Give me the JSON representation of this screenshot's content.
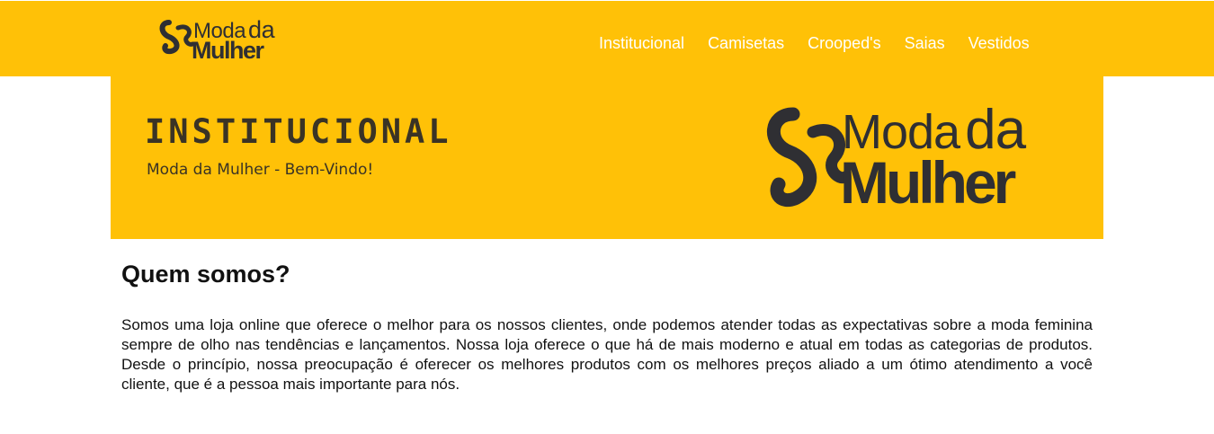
{
  "header": {
    "logo": {
      "line1": "Moda",
      "line1_accent": "da",
      "line2": "Mulher",
      "icon": "swirl-s-icon"
    },
    "nav": [
      {
        "label": "Institucional"
      },
      {
        "label": "Camisetas"
      },
      {
        "label": "Crooped's"
      },
      {
        "label": "Saias"
      },
      {
        "label": "Vestidos"
      }
    ]
  },
  "banner": {
    "title": "INSTITUCIONAL",
    "subtitle": "Moda da Mulher - Bem-Vindo!",
    "logo": {
      "line1": "Moda",
      "line1_accent": "da",
      "line2": "Mulher",
      "icon": "swirl-s-icon"
    }
  },
  "main": {
    "heading": "Quem somos?",
    "paragraph": "Somos uma loja online que oferece o melhor para os nossos clientes, onde podemos atender todas as expectativas sobre a moda feminina sempre de olho nas tendências e lançamentos. Nossa loja oferece o que há de mais moderno e atual em todas as categorias de produtos. Desde o princípio, nossa preocupação é oferecer os melhores produtos com os melhores preços aliado a um ótimo atendimento a você cliente, que é a pessoa mais importante para nós."
  },
  "colors": {
    "brand_yellow": "#ffc107",
    "logo_dark": "#2f2f33",
    "nav_text": "#ffffff"
  }
}
